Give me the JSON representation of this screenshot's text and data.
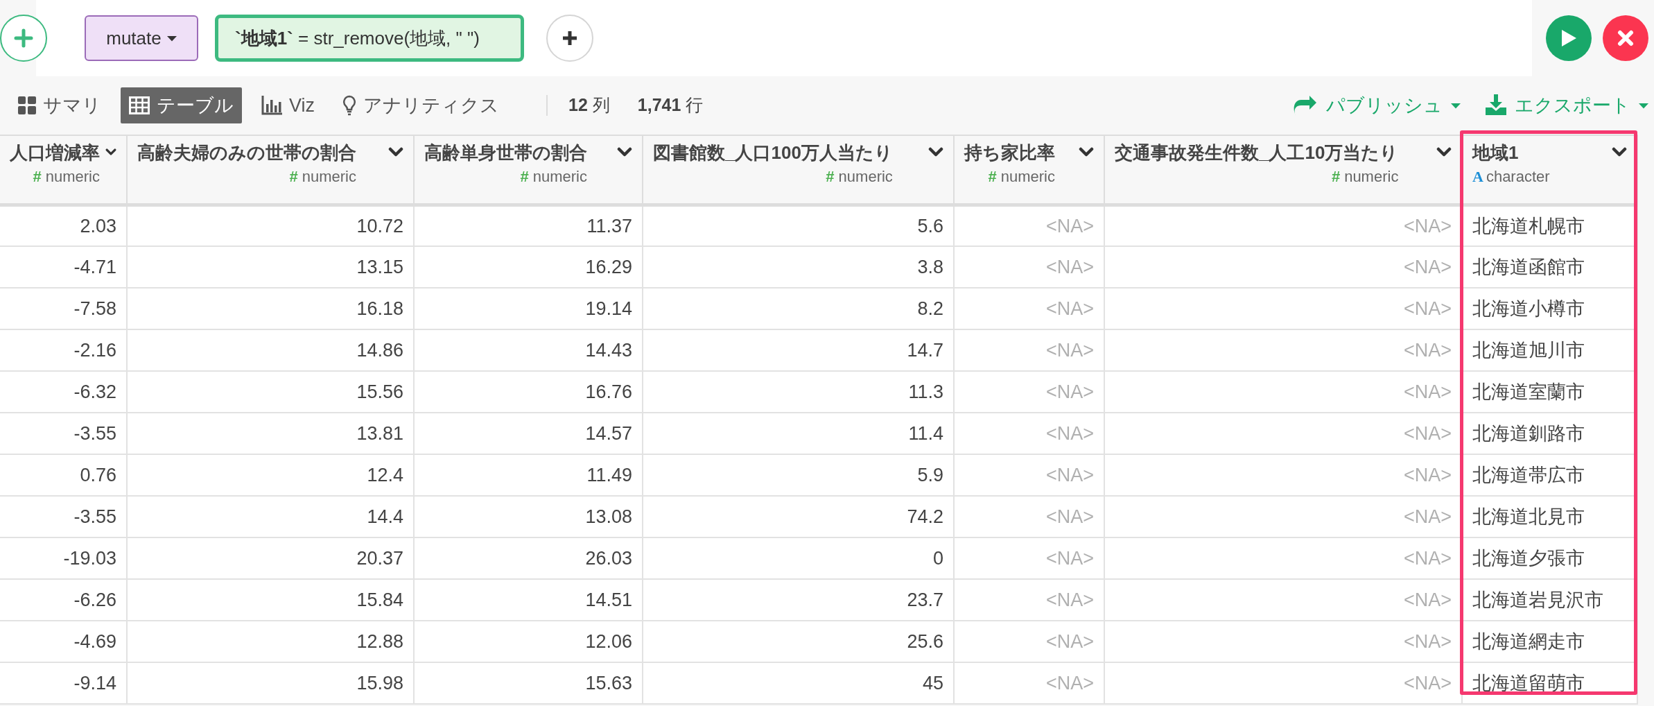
{
  "step_bar": {
    "command": "mutate",
    "formula": "**`地域1`** = str_remove(地域, \" \")"
  },
  "view_tabs": [
    {
      "label": "サマリ",
      "selected": false
    },
    {
      "label": "テーブル",
      "selected": true
    },
    {
      "label": "Viz",
      "selected": false
    },
    {
      "label": "アナリティクス",
      "selected": false
    }
  ],
  "counts": [
    {
      "value": "12",
      "unit": "列"
    },
    {
      "value": "1,741",
      "unit": "行"
    }
  ],
  "actions": [
    "パブリッシュ",
    "エクスポート"
  ],
  "table": {
    "columns": [
      {
        "name": "人口増減率",
        "kind": "number",
        "type_icon": "#",
        "type": "numeric",
        "highlighted": false
      },
      {
        "name": "高齢夫婦のみの世帯の割合",
        "kind": "number",
        "type_icon": "#",
        "type": "numeric",
        "highlighted": false
      },
      {
        "name": "高齢単身世帯の割合",
        "kind": "number",
        "type_icon": "#",
        "type": "numeric",
        "highlighted": false
      },
      {
        "name": "図書館数_人口100万人当たり",
        "kind": "number",
        "type_icon": "#",
        "type": "numeric",
        "highlighted": false
      },
      {
        "name": "持ち家比率",
        "kind": "number",
        "type_icon": "#",
        "type": "numeric",
        "highlighted": false
      },
      {
        "name": "交通事故発生件数_人工10万当たり",
        "kind": "number",
        "type_icon": "#",
        "type": "numeric",
        "highlighted": false
      },
      {
        "name": "地域1",
        "kind": "text",
        "type_icon": "A",
        "type": "character",
        "highlighted": true
      }
    ],
    "rows": [
      [
        "2.03",
        "10.72",
        "11.37",
        "5.6",
        {
          "text": "<NA>",
          "missing": true
        },
        {
          "text": "<NA>",
          "missing": true
        },
        "北海道札幌市"
      ],
      [
        "-4.71",
        "13.15",
        "16.29",
        "3.8",
        {
          "text": "<NA>",
          "missing": true
        },
        {
          "text": "<NA>",
          "missing": true
        },
        "北海道函館市"
      ],
      [
        "-7.58",
        "16.18",
        "19.14",
        "8.2",
        {
          "text": "<NA>",
          "missing": true
        },
        {
          "text": "<NA>",
          "missing": true
        },
        "北海道小樽市"
      ],
      [
        "-2.16",
        "14.86",
        "14.43",
        "14.7",
        {
          "text": "<NA>",
          "missing": true
        },
        {
          "text": "<NA>",
          "missing": true
        },
        "北海道旭川市"
      ],
      [
        "-6.32",
        "15.56",
        "16.76",
        "11.3",
        {
          "text": "<NA>",
          "missing": true
        },
        {
          "text": "<NA>",
          "missing": true
        },
        "北海道室蘭市"
      ],
      [
        "-3.55",
        "13.81",
        "14.57",
        "11.4",
        {
          "text": "<NA>",
          "missing": true
        },
        {
          "text": "<NA>",
          "missing": true
        },
        "北海道釧路市"
      ],
      [
        "0.76",
        "12.4",
        "11.49",
        "5.9",
        {
          "text": "<NA>",
          "missing": true
        },
        {
          "text": "<NA>",
          "missing": true
        },
        "北海道帯広市"
      ],
      [
        "-3.55",
        "14.4",
        "13.08",
        "74.2",
        {
          "text": "<NA>",
          "missing": true
        },
        {
          "text": "<NA>",
          "missing": true
        },
        "北海道北見市"
      ],
      [
        "-19.03",
        "20.37",
        "26.03",
        "0",
        {
          "text": "<NA>",
          "missing": true
        },
        {
          "text": "<NA>",
          "missing": true
        },
        "北海道夕張市"
      ],
      [
        "-6.26",
        "15.84",
        "14.51",
        "23.7",
        {
          "text": "<NA>",
          "missing": true
        },
        {
          "text": "<NA>",
          "missing": true
        },
        "北海道岩見沢市"
      ],
      [
        "-4.69",
        "12.88",
        "12.06",
        "25.6",
        {
          "text": "<NA>",
          "missing": true
        },
        {
          "text": "<NA>",
          "missing": true
        },
        "北海道網走市"
      ],
      [
        "-9.14",
        "15.98",
        "15.63",
        "45",
        {
          "text": "<NA>",
          "missing": true
        },
        {
          "text": "<NA>",
          "missing": true
        },
        "北海道留萌市"
      ]
    ]
  }
}
